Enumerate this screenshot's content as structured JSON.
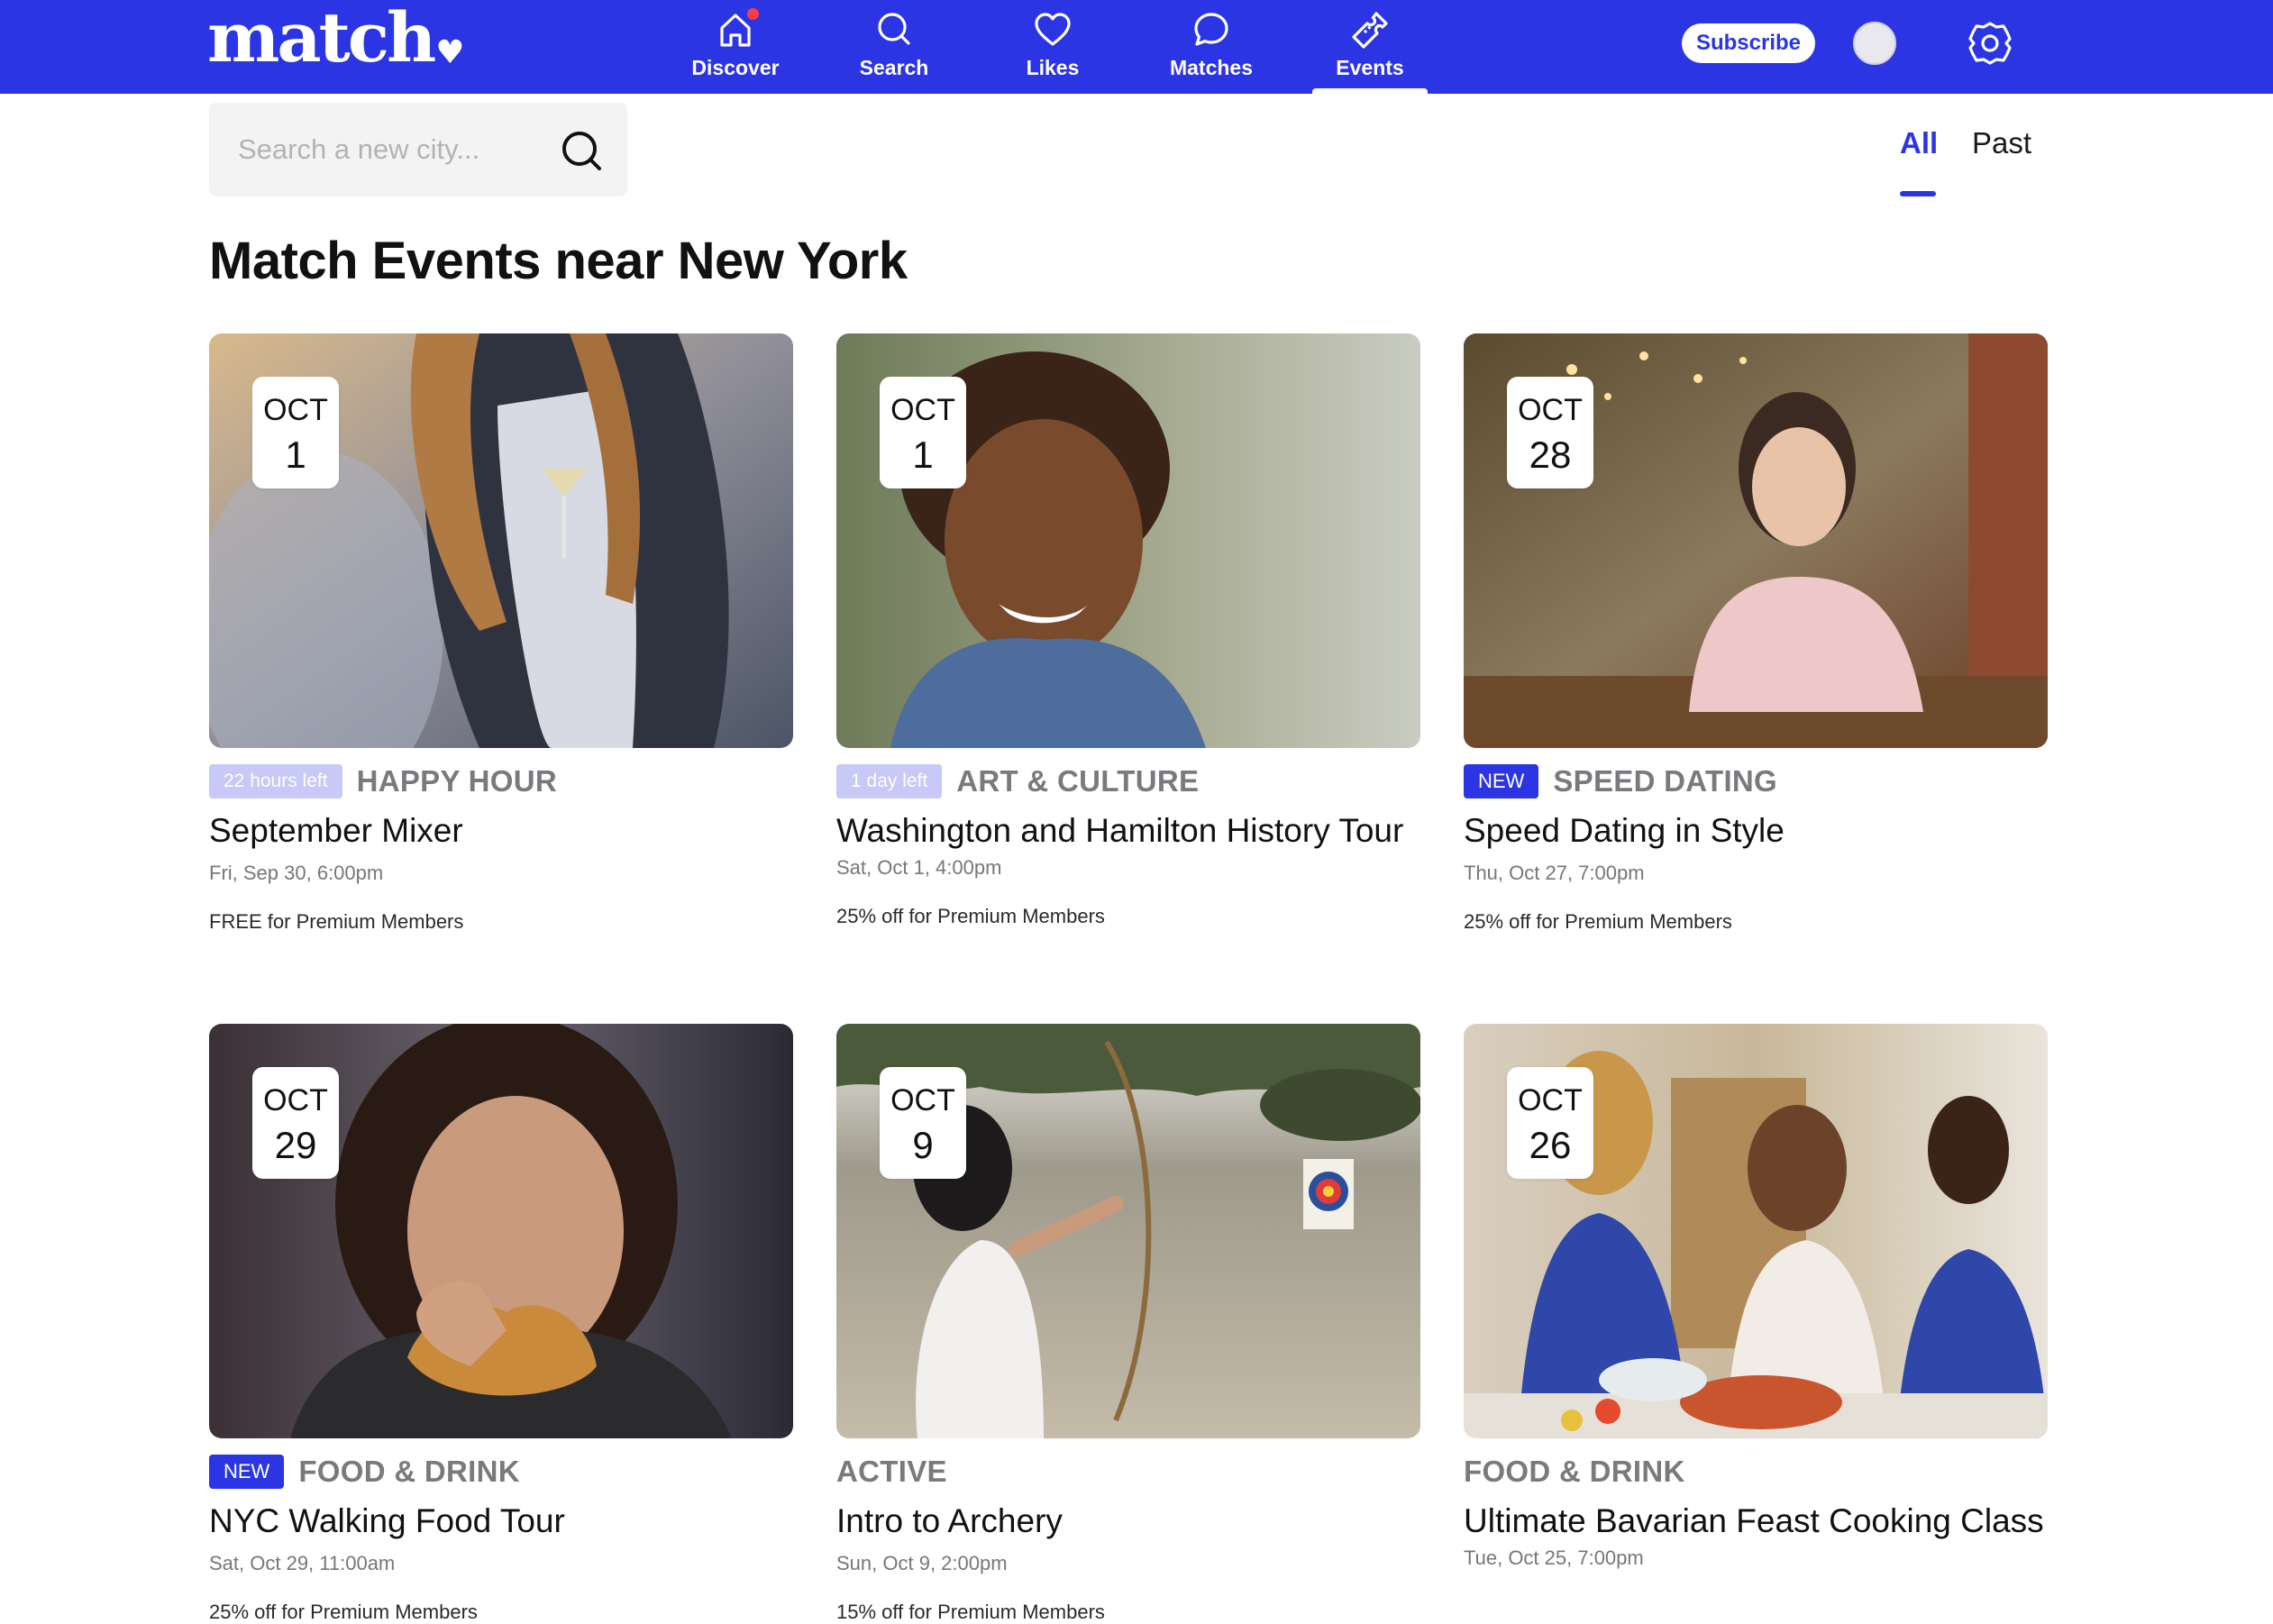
{
  "brand": {
    "logo_text": "match",
    "logo_mark": "♥"
  },
  "colors": {
    "brand_blue": "#2b35e3",
    "notification_red": "#ff3b45",
    "timeleft_tag": "#c7c9f6"
  },
  "nav": {
    "items": [
      {
        "label": "Discover",
        "icon": "home-icon",
        "has_dot": true
      },
      {
        "label": "Search",
        "icon": "search-icon"
      },
      {
        "label": "Likes",
        "icon": "heart-icon"
      },
      {
        "label": "Matches",
        "icon": "chat-bubble-icon"
      },
      {
        "label": "Events",
        "icon": "ticket-icon",
        "active": true
      }
    ],
    "subscribe_label": "Subscribe",
    "settings_icon": "gear-icon",
    "avatar_icon": "avatar"
  },
  "search": {
    "placeholder": "Search a new city..."
  },
  "filters": {
    "all": "All",
    "past": "Past",
    "selected": "All"
  },
  "page_title": "Match Events near New York",
  "events": [
    {
      "month": "OCT",
      "day": "1",
      "tag": "22 hours left",
      "category": "HAPPY HOUR",
      "title": "September Mixer",
      "datetime": "Fri, Sep 30, 6:00pm",
      "promo": "FREE for Premium Members"
    },
    {
      "month": "OCT",
      "day": "1",
      "tag": "1 day left",
      "category": "ART & CULTURE",
      "title": "Washington and Hamilton History Tour",
      "datetime": "Sat, Oct 1, 4:00pm",
      "promo": "25% off for Premium Members"
    },
    {
      "month": "OCT",
      "day": "28",
      "tag": "NEW",
      "category": "SPEED DATING",
      "title": "Speed Dating in Style",
      "datetime": "Thu, Oct 27, 7:00pm",
      "promo": "25% off for Premium Members"
    },
    {
      "month": "OCT",
      "day": "29",
      "tag": "NEW",
      "category": "FOOD & DRINK",
      "title": "NYC Walking Food Tour",
      "datetime": "Sat, Oct 29, 11:00am",
      "promo": "25% off for Premium Members"
    },
    {
      "month": "OCT",
      "day": "9",
      "tag": "",
      "category": "ACTIVE",
      "title": "Intro to Archery",
      "datetime": "Sun, Oct 9, 2:00pm",
      "promo": "15% off for Premium Members"
    },
    {
      "month": "OCT",
      "day": "26",
      "tag": "",
      "category": "FOOD & DRINK",
      "title": "Ultimate Bavarian Feast Cooking Class",
      "datetime": "Tue, Oct 25, 7:00pm",
      "promo": ""
    }
  ]
}
